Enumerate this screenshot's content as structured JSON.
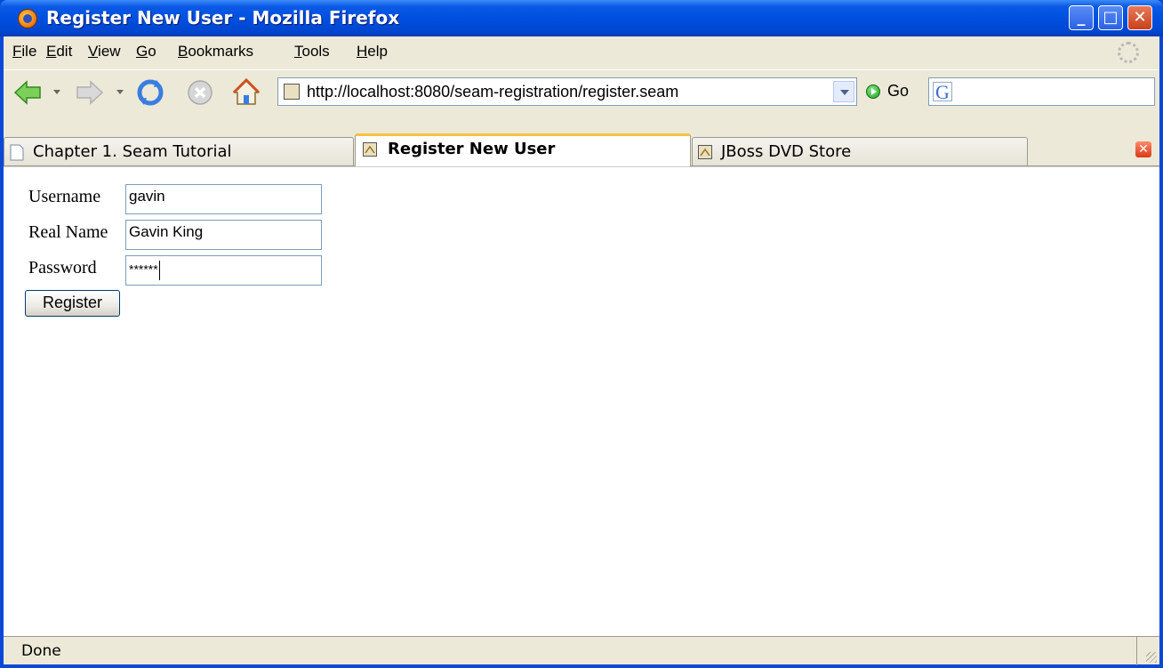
{
  "window": {
    "title": "Register New User - Mozilla Firefox"
  },
  "menu": {
    "items": [
      {
        "label": "File",
        "mnemonic": "F",
        "rest": "ile"
      },
      {
        "label": "Edit",
        "mnemonic": "E",
        "rest": "dit"
      },
      {
        "label": "View",
        "mnemonic": "V",
        "rest": "iew"
      },
      {
        "label": "Go",
        "mnemonic": "G",
        "rest": "o"
      },
      {
        "label": "Bookmarks",
        "mnemonic": "B",
        "rest": "ookmarks"
      },
      {
        "label": "Tools",
        "mnemonic": "T",
        "rest": "ools"
      },
      {
        "label": "Help",
        "mnemonic": "H",
        "rest": "elp"
      }
    ]
  },
  "toolbar": {
    "url": "http://localhost:8080/seam-registration/register.seam",
    "go_label": "Go"
  },
  "tabs": [
    {
      "label": "Chapter 1. Seam Tutorial",
      "active": false
    },
    {
      "label": "Register New User",
      "active": true
    },
    {
      "label": "JBoss DVD Store",
      "active": false
    }
  ],
  "form": {
    "username_label": "Username",
    "username_value": "gavin",
    "realname_label": "Real Name",
    "realname_value": "Gavin King",
    "password_label": "Password",
    "password_value": "******",
    "submit_label": "Register"
  },
  "status": {
    "text": "Done"
  },
  "colors": {
    "titlebar": "#0050e0",
    "chrome": "#ece9d8",
    "active_tab_accent": "#f6c240"
  }
}
